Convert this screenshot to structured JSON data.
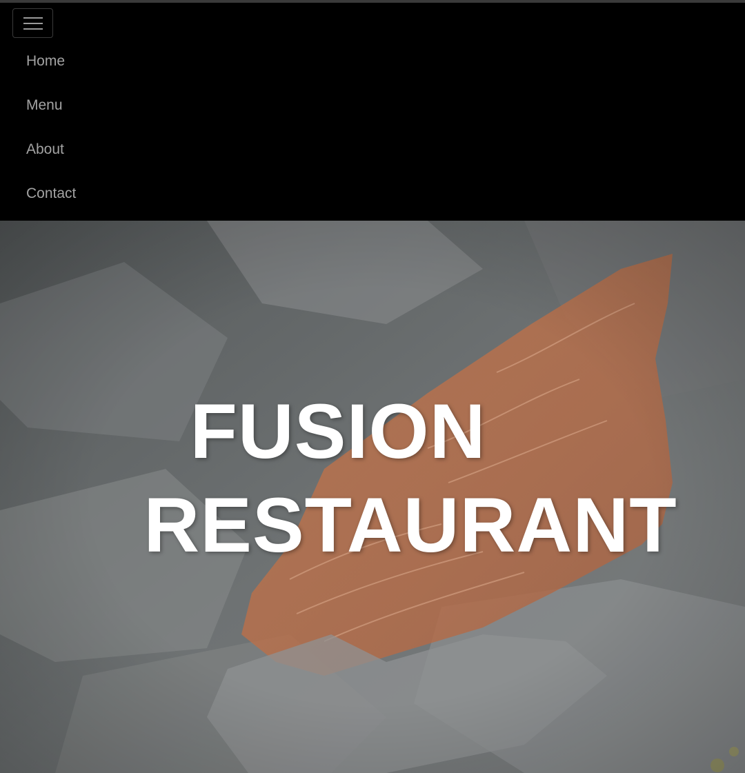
{
  "navbar": {
    "toggler_icon": "hamburger-menu-icon",
    "items": [
      {
        "label": "Home"
      },
      {
        "label": "Menu"
      },
      {
        "label": "About"
      },
      {
        "label": "Contact"
      }
    ]
  },
  "hero": {
    "title_line1": "FUSION",
    "title_line2": "RESTAURANT",
    "background_image": "salmon-fillet-on-parchment-photo"
  },
  "colors": {
    "navbar_bg": "#000000",
    "nav_link": "#a3a3a3",
    "hero_title": "#ffffff",
    "hero_overlay": "#5b5f60",
    "salmon": "#c8774a"
  }
}
